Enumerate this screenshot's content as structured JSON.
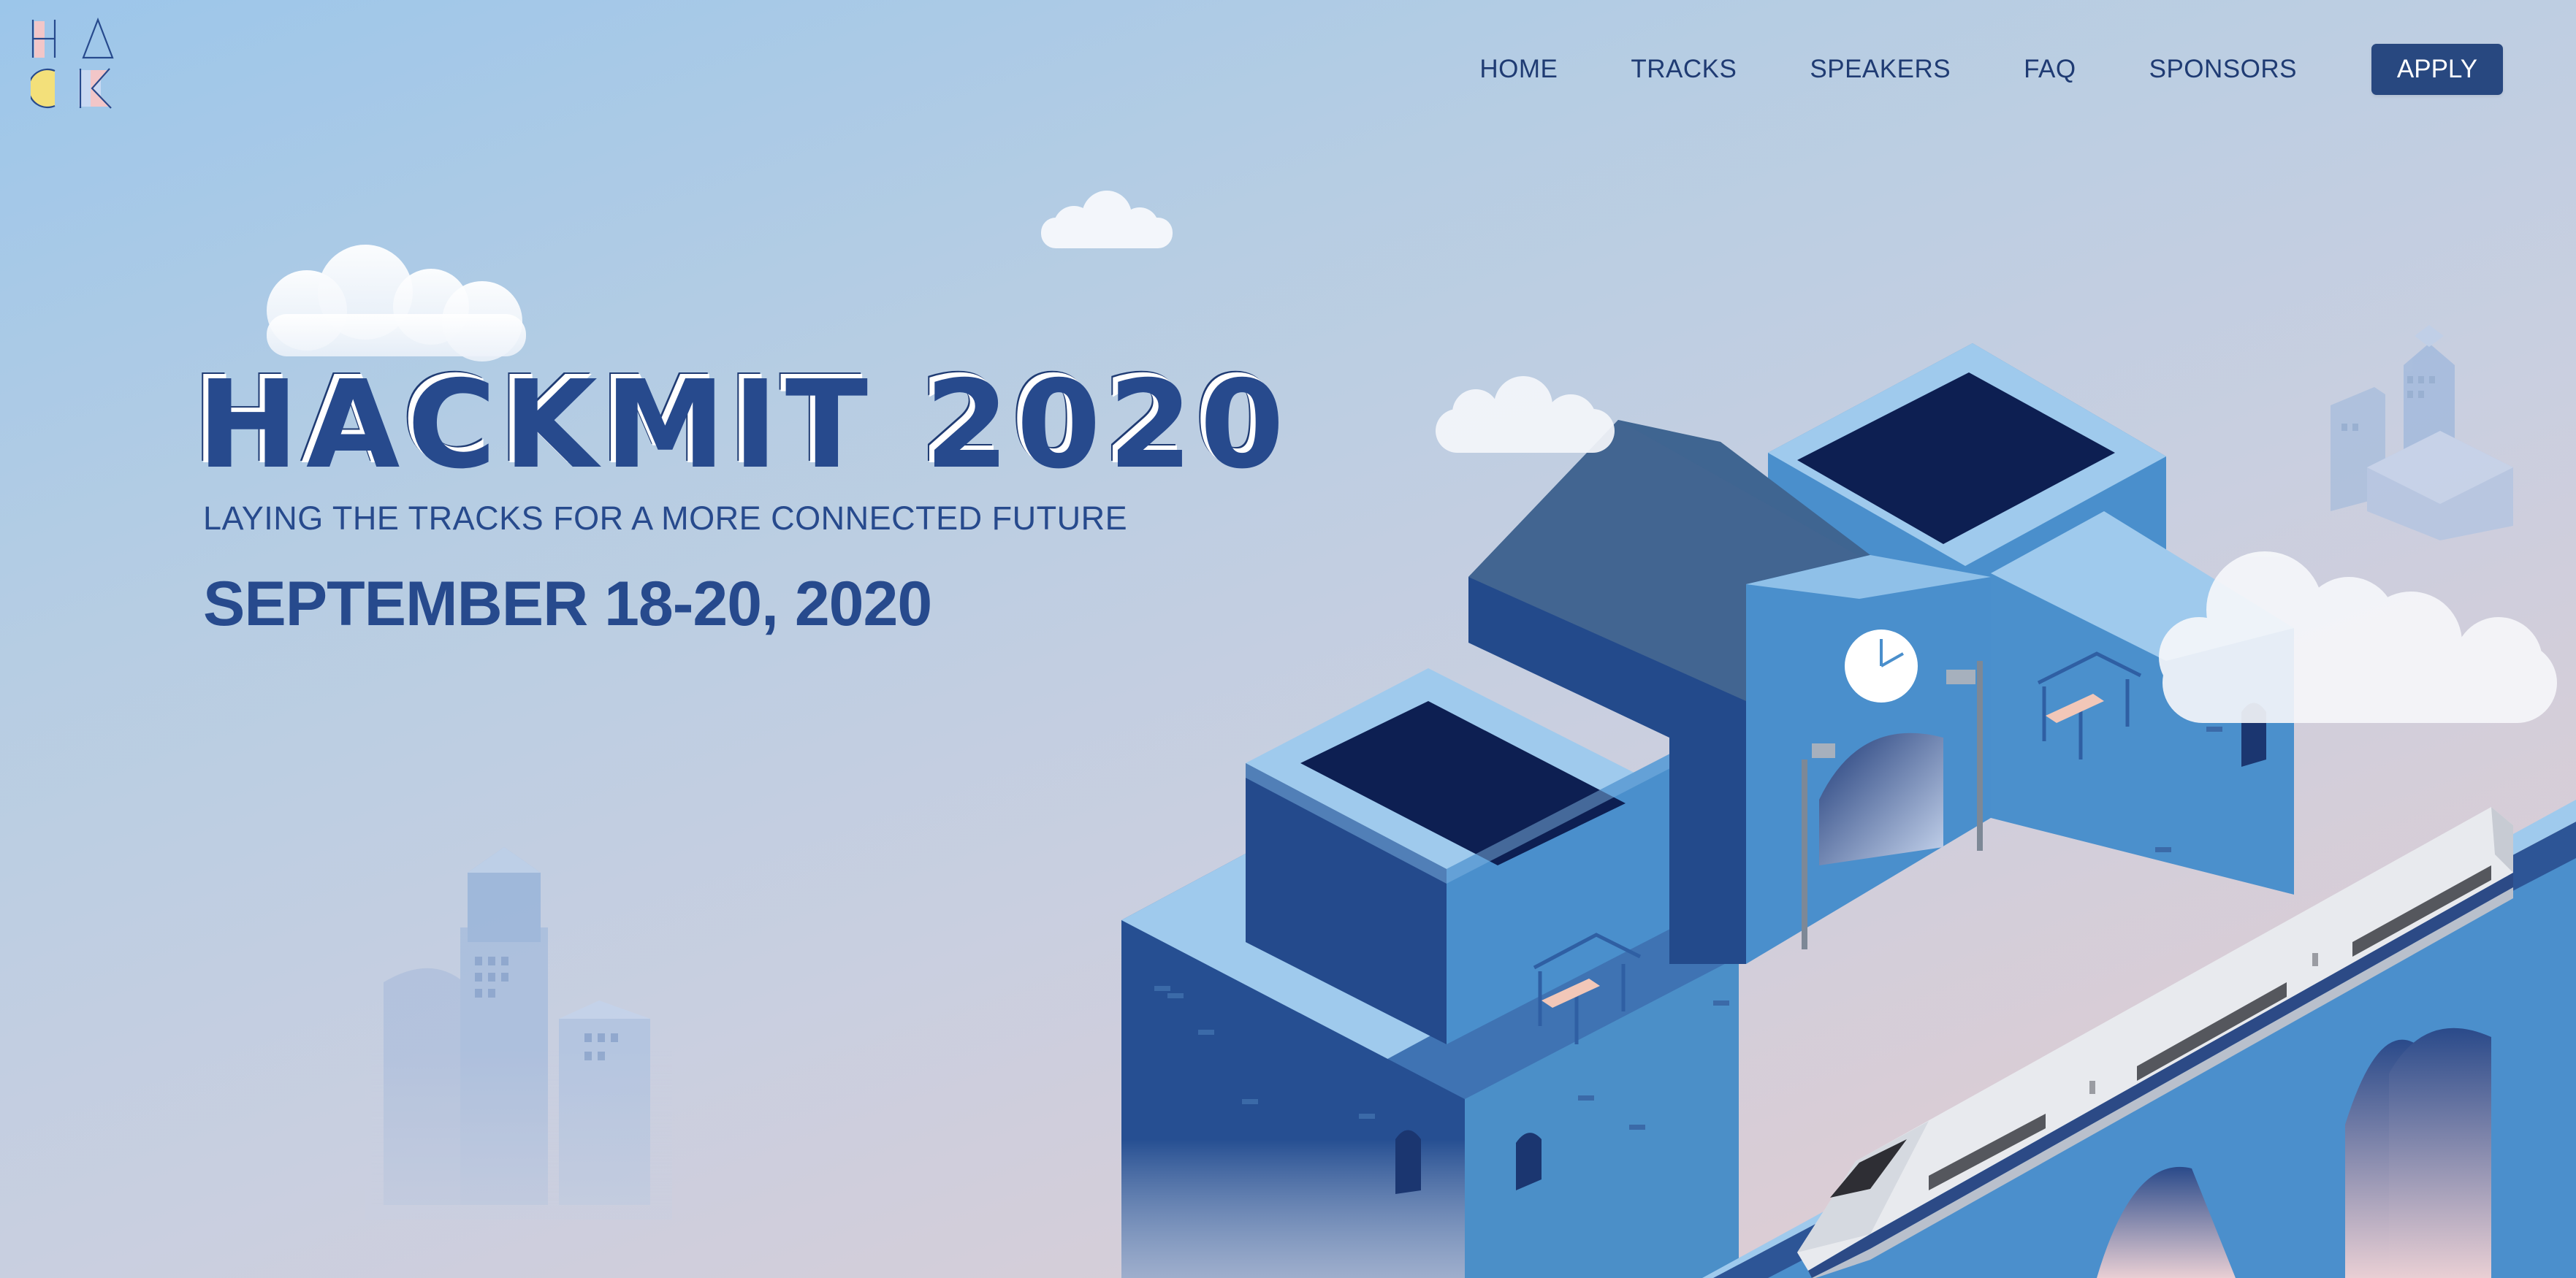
{
  "logo": {
    "letters": [
      "H",
      "A",
      "C",
      "K"
    ]
  },
  "nav": {
    "items": [
      {
        "label": "HOME"
      },
      {
        "label": "TRACKS"
      },
      {
        "label": "SPEAKERS"
      },
      {
        "label": "FAQ"
      },
      {
        "label": "SPONSORS"
      }
    ],
    "apply_label": "APPLY"
  },
  "hero": {
    "title": "HACKMIT 2020",
    "tagline": "LAYING THE TRACKS FOR A MORE CONNECTED FUTURE",
    "date": "SEPTEMBER 18-20, 2020"
  },
  "colors": {
    "primary": "#274a8d",
    "button": "#284880",
    "sky_top": "#9cc6ea",
    "sky_bottom": "#e6ccd0"
  }
}
